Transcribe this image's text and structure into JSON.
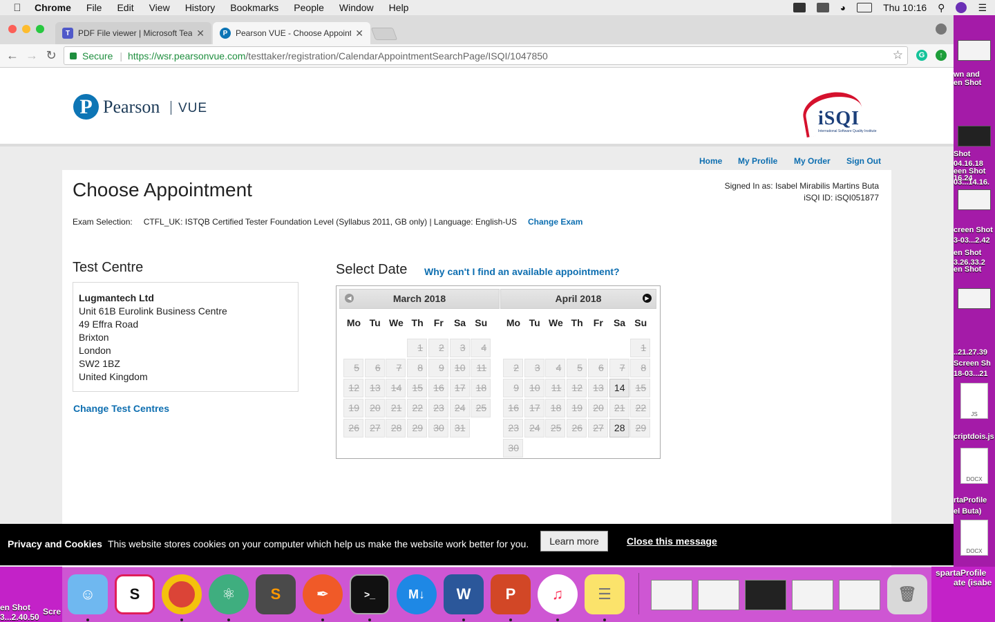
{
  "menubar": {
    "app": "Chrome",
    "items": [
      "File",
      "Edit",
      "View",
      "History",
      "Bookmarks",
      "People",
      "Window",
      "Help"
    ],
    "clock": "Thu 10:16"
  },
  "browser": {
    "tabs": [
      {
        "title": "PDF File viewer | Microsoft Teams",
        "favicon": "teams-icon"
      },
      {
        "title": "Pearson VUE - Choose Appointment",
        "favicon": "pearson-icon"
      }
    ],
    "secure_label": "Secure",
    "url_host": "https://wsr.pearsonvue.com",
    "url_path": "/testtaker/registration/CalendarAppointmentSearchPage/ISQI/1047850"
  },
  "header": {
    "brand": "Pearson",
    "brand_sub": "VUE",
    "partner": "iSQI",
    "partner_sub": "International Software Quality Institute"
  },
  "nav": {
    "home": "Home",
    "profile": "My Profile",
    "order": "My Order",
    "signout": "Sign Out"
  },
  "main": {
    "title": "Choose Appointment",
    "signed_in": "Signed In as: Isabel Mirabilis Martins Buta",
    "isqi_id": "iSQI ID: iSQI051877",
    "exam_label": "Exam Selection:",
    "exam_value": "CTFL_UK: ISTQB Certified Tester Foundation Level (Syllabus 2011, GB only) | Language: English-US",
    "change_exam": "Change Exam"
  },
  "centre": {
    "heading": "Test Centre",
    "name": "Lugmantech Ltd",
    "address": [
      "Unit 61B Eurolink Business Centre",
      "49 Effra Road",
      "Brixton",
      "London",
      "SW2 1BZ",
      "United Kingdom"
    ],
    "change_link": "Change Test Centres"
  },
  "date": {
    "heading": "Select Date",
    "why_link": "Why can't I find an available appointment?"
  },
  "calendar": {
    "weekdays": [
      "Mo",
      "Tu",
      "We",
      "Th",
      "Fr",
      "Sa",
      "Su"
    ],
    "months": [
      {
        "label": "March 2018",
        "first_weekday": 3,
        "days": 31,
        "available": []
      },
      {
        "label": "April 2018",
        "first_weekday": 6,
        "days": 30,
        "available": [
          14,
          28
        ]
      }
    ]
  },
  "cookie": {
    "title": "Privacy and Cookies",
    "text": "This website stores cookies on your computer which help us make the website work better for you.",
    "learn_more": "Learn more",
    "close": "Close this message"
  },
  "desktop": {
    "labels": [
      "wn and",
      "en Shot",
      "Shot",
      "04.16.18",
      "een Shot",
      "16.24",
      "03...14.16.",
      "creen Shot",
      "3-03...2.42",
      "en Shot",
      "3.26.33.2",
      "en Shot",
      "..21.27.39",
      "Screen Sh",
      "18-03...21",
      "criptdois.js",
      "rtaProfile",
      "el Buta)",
      "spartaProfile",
      "ate (isabe"
    ],
    "bottom_labels": [
      "en Shot",
      "3...2.40.50",
      "Scre"
    ]
  }
}
